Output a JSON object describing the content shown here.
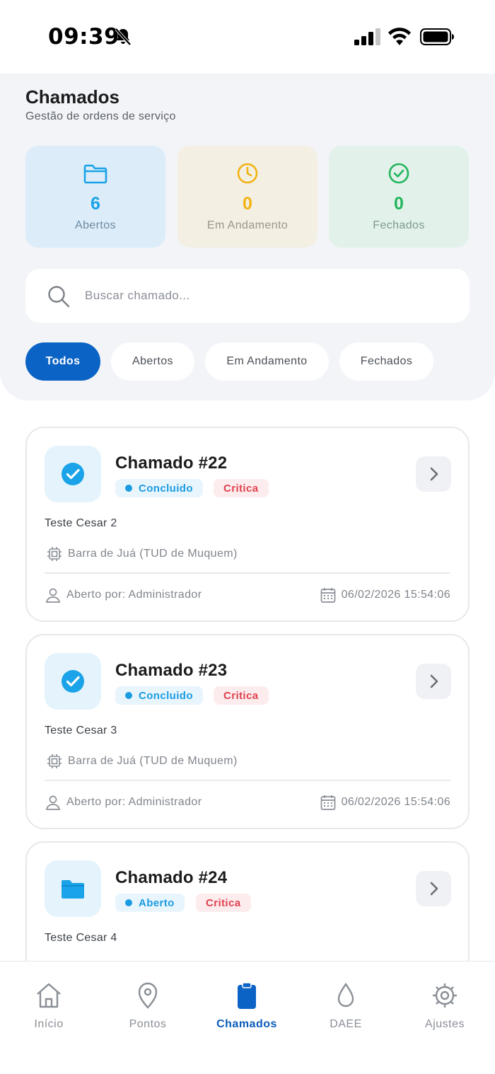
{
  "status_bar": {
    "time": "09:39"
  },
  "header": {
    "title": "Chamados",
    "subtitle": "Gestão de ordens de serviço"
  },
  "stats": [
    {
      "value": "6",
      "label": "Abertos",
      "color": "#1aa3e8",
      "icon": "folder-icon"
    },
    {
      "value": "0",
      "label": "Em Andamento",
      "color": "#f2b312",
      "icon": "clock-icon"
    },
    {
      "value": "0",
      "label": "Fechados",
      "color": "#22b55e",
      "icon": "check-circle-icon"
    }
  ],
  "search": {
    "placeholder": "Buscar chamado...",
    "value": ""
  },
  "filters": [
    {
      "label": "Todos",
      "active": true
    },
    {
      "label": "Abertos",
      "active": false
    },
    {
      "label": "Em Andamento",
      "active": false
    },
    {
      "label": "Fechados",
      "active": false
    }
  ],
  "tickets": [
    {
      "title": "Chamado #22",
      "status": "Concluido",
      "priority": "Critica",
      "description": "Teste Cesar 2",
      "location": "Barra de Juá (TUD de Muquem)",
      "author": "Aberto por: Administrador",
      "date": "06/02/2026 15:54:06",
      "icon": "check-circle-icon"
    },
    {
      "title": "Chamado #23",
      "status": "Concluido",
      "priority": "Critica",
      "description": "Teste Cesar 3",
      "location": "Barra de Juá (TUD de Muquem)",
      "author": "Aberto por: Administrador",
      "date": "06/02/2026 15:54:06",
      "icon": "check-circle-icon"
    },
    {
      "title": "Chamado #24",
      "status": "Aberto",
      "priority": "Critica",
      "description": "Teste Cesar 4",
      "icon": "folder-icon"
    }
  ],
  "nav": [
    {
      "label": "Início",
      "icon": "home-icon",
      "active": false
    },
    {
      "label": "Pontos",
      "icon": "map-pin-icon",
      "active": false
    },
    {
      "label": "Chamados",
      "icon": "clipboard-icon",
      "active": true
    },
    {
      "label": "DAEE",
      "icon": "water-drop-icon",
      "active": false
    },
    {
      "label": "Ajustes",
      "icon": "gear-icon",
      "active": false
    }
  ],
  "colors": {
    "primary": "#0b63c5",
    "accent_blue": "#1a9be0",
    "critical": "#e0424f"
  }
}
